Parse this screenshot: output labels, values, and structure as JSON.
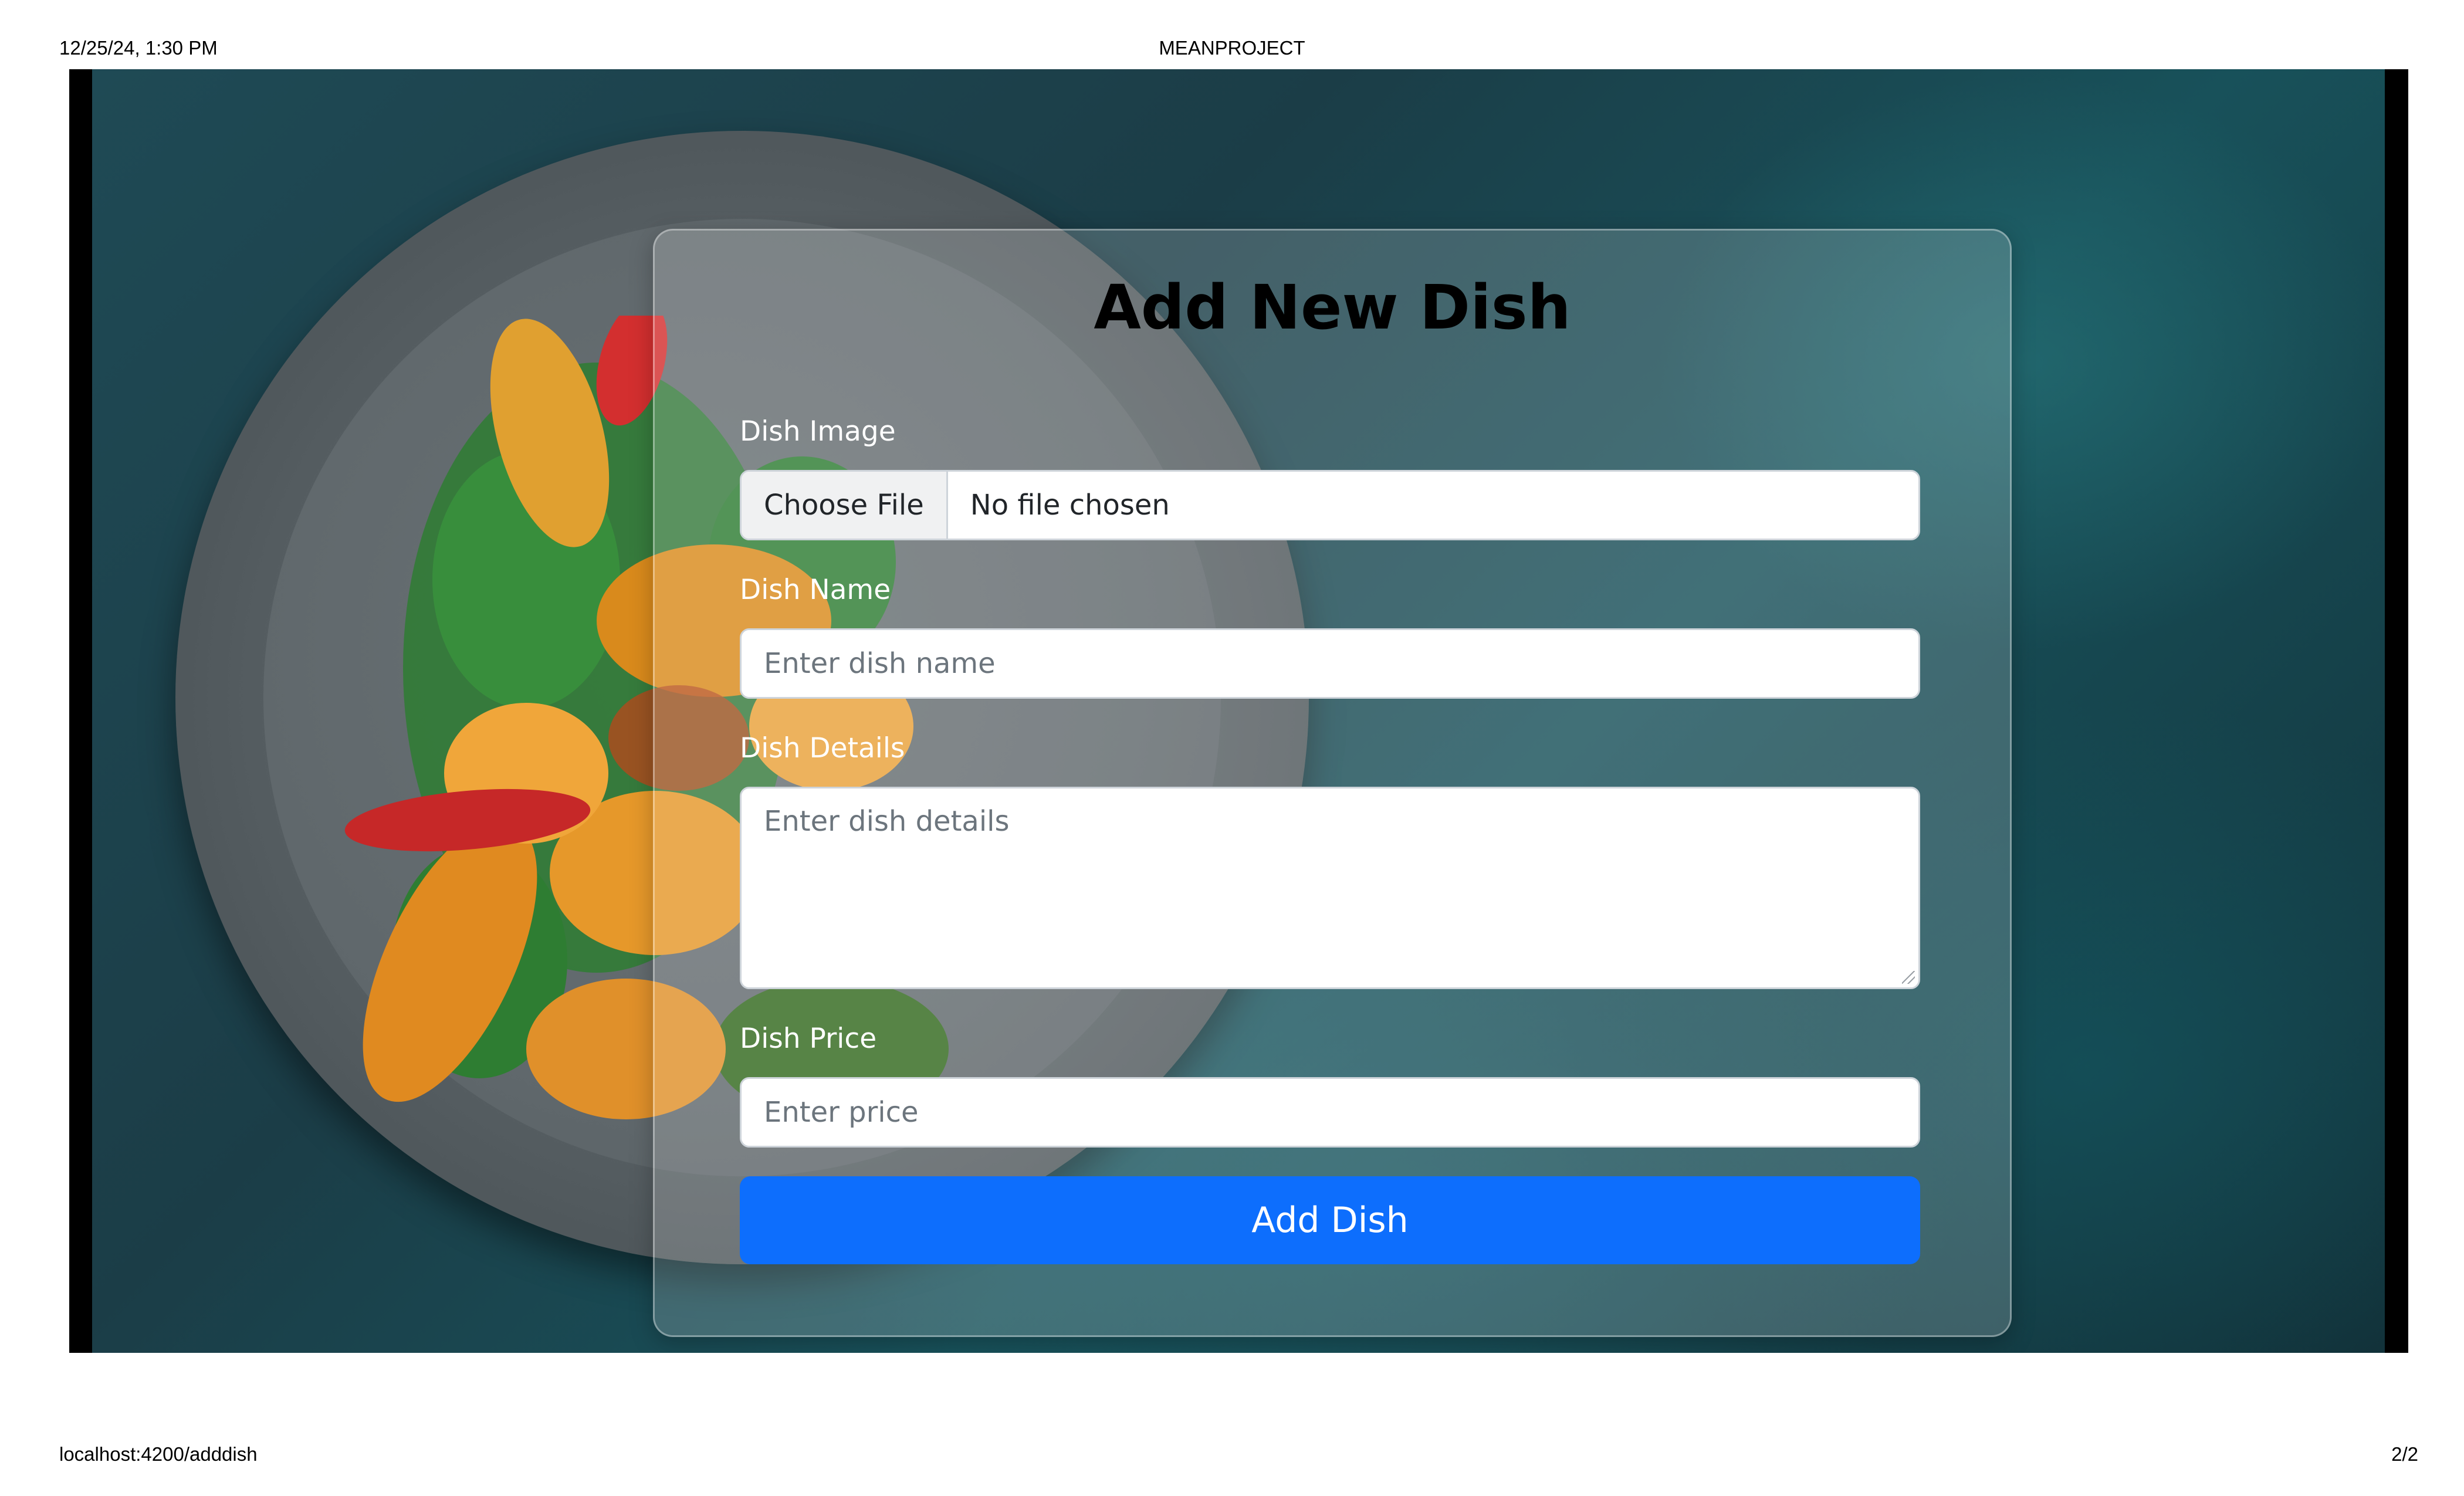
{
  "print_header": {
    "datetime": "12/25/24, 1:30 PM",
    "title": "MEANPROJECT"
  },
  "print_footer": {
    "url": "localhost:4200/adddish",
    "page": "2/2"
  },
  "form": {
    "title": "Add New Dish",
    "image": {
      "label": "Dish Image",
      "button": "Choose File",
      "status": "No file chosen"
    },
    "name": {
      "label": "Dish Name",
      "placeholder": "Enter dish name"
    },
    "details": {
      "label": "Dish Details",
      "placeholder": "Enter dish details"
    },
    "price": {
      "label": "Dish Price",
      "placeholder": "Enter price"
    },
    "submit_label": "Add Dish"
  },
  "colors": {
    "primary_button": "#0d6efd",
    "background": "#1b3d47"
  },
  "background_image": "plate-of-roasted-vegetables-with-herbs"
}
